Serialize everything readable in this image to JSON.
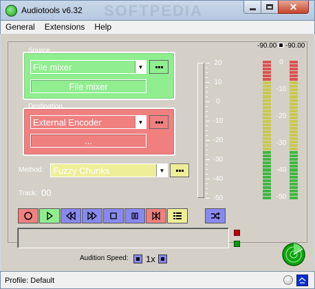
{
  "window": {
    "title": "Audiotools v6.32",
    "watermark": "SOFTPEDIA"
  },
  "menu": [
    "General",
    "Extensions",
    "Help"
  ],
  "source": {
    "label": "Source",
    "selected": "File mixer",
    "field": "File mixer"
  },
  "destination": {
    "label": "Destination",
    "selected": "External Encoder",
    "field": "..."
  },
  "method": {
    "label": "Method:",
    "selected": "Fuzzy Chunks"
  },
  "track": {
    "label": "Track:",
    "value": "00"
  },
  "scale": {
    "labels": [
      "20",
      "10",
      "0",
      "-10",
      "-20",
      "-30",
      "-40",
      "-50"
    ]
  },
  "meters": {
    "left_db": "-90.00",
    "right_db": "-90.00",
    "labels": [
      "0",
      "-10",
      "-20",
      "-30",
      "-40",
      "-50"
    ],
    "level_left": 0,
    "level_right": 0,
    "colors": {
      "red": "#e05050",
      "yellow": "#c8c850",
      "green": "#40b840"
    }
  },
  "transport": {
    "buttons": [
      {
        "name": "record-button",
        "icon": "record-icon",
        "color": "#f08080"
      },
      {
        "name": "play-button",
        "icon": "play-icon",
        "color": "#90ee90"
      },
      {
        "name": "rewind-button",
        "icon": "rewind-icon",
        "color": "#8888ee"
      },
      {
        "name": "fast-forward-button",
        "icon": "fast-forward-icon",
        "color": "#8888ee"
      },
      {
        "name": "stop-button",
        "icon": "stop-icon",
        "color": "#8888ee"
      },
      {
        "name": "pause-button",
        "icon": "pause-icon",
        "color": "#8888ee"
      },
      {
        "name": "skip-button",
        "icon": "skip-icon",
        "color": "#f08080"
      },
      {
        "name": "playlist-button",
        "icon": "list-icon",
        "color": "#eeee99"
      }
    ],
    "shuffle_icon": "shuffle-icon"
  },
  "audition": {
    "label": "Audition Speed:",
    "value": "1x"
  },
  "status": {
    "text": "Profile: Default"
  }
}
